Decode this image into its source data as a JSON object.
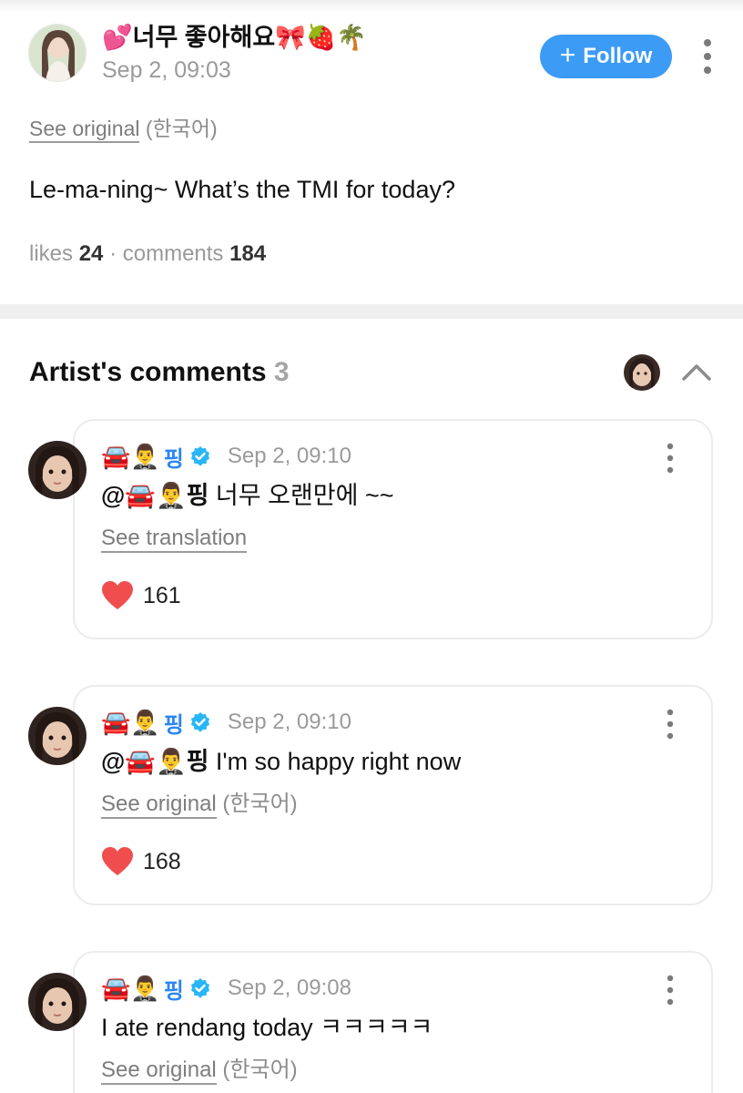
{
  "post": {
    "author": "💕너무 좋아해요🎀🍓🌴",
    "time": "Sep 2, 09:03",
    "follow_label": "Follow",
    "see_original": "See original",
    "language": "(한국어)",
    "body": "Le-ma-ning~ What’s the TMI for today?",
    "likes_label": "likes",
    "likes_count": "24",
    "separator": "·",
    "comments_label": "comments",
    "comments_count": "184"
  },
  "artist_comments": {
    "title": "Artist's comments",
    "count": "3"
  },
  "comments": [
    {
      "emoji": "🚘🤵‍♂️",
      "name": "핑",
      "time": "Sep 2, 09:10",
      "mention": "@🚘🤵‍♂️핑",
      "text": " 너무 오랜만에 ~~",
      "link": "See translation",
      "lang": "",
      "likes": "161"
    },
    {
      "emoji": "🚘🤵‍♂️",
      "name": "핑",
      "time": "Sep 2, 09:10",
      "mention": "@🚘🤵‍♂️핑",
      "text": " I'm so happy right now",
      "link": "See original",
      "lang": "(한국어)",
      "likes": "168"
    },
    {
      "emoji": "🚘🤵‍♂️",
      "name": "핑",
      "time": "Sep 2, 09:08",
      "mention": "",
      "text": "I ate rendang today ㅋㅋㅋㅋㅋ",
      "link": "See original",
      "lang": "(한국어)",
      "likes": ""
    }
  ],
  "colors": {
    "accent": "#3b9bf5",
    "name_blue": "#2a86f2",
    "verified": "#29b6f6",
    "heart": "#f04e4e",
    "muted": "#9a9a9a"
  },
  "icons": {
    "follow": "plus-icon",
    "more": "vertical-dots-icon",
    "collapse": "chevron-up-icon",
    "verified": "verified-check-icon",
    "like": "heart-icon"
  }
}
